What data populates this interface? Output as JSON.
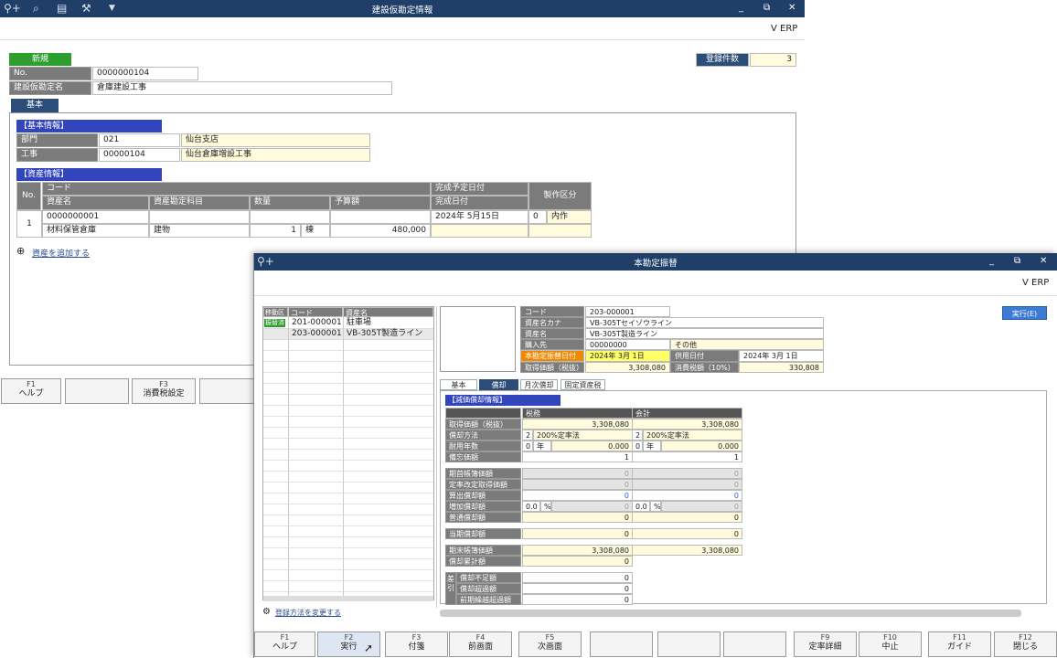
{
  "win1": {
    "title": "建設仮勘定情報",
    "brand": "V ERP",
    "status": "新規",
    "no_label": "No.",
    "no_value": "0000000104",
    "name_label": "建設仮勘定名",
    "name_value": "倉庫建設工事",
    "count_label": "登録件数",
    "count_value": "3",
    "tab": "基本",
    "basic_section": "【基本情報】",
    "dept_label": "部門",
    "dept_code": "021",
    "dept_name": "仙台支店",
    "work_label": "工事",
    "work_code": "00000104",
    "work_name": "仙台倉庫増設工事",
    "asset_section": "【資産情報】",
    "th_no": "No.",
    "th_code": "コード",
    "th_asset_name": "資産名",
    "th_account": "資産勘定科目",
    "th_qty": "数量",
    "th_budget": "予算額",
    "th_plan_date": "完成予定日付",
    "th_done_date": "完成日付",
    "th_make": "製作区分",
    "row_no": "1",
    "row_code": "0000000001",
    "row_name": "材料保管倉庫",
    "row_account": "建物",
    "row_qty": "1",
    "row_unit": "棟",
    "row_budget": "480,000",
    "row_plan_date": "2024年 5月15日",
    "row_make_code": "0",
    "row_make": "内作",
    "add_link": "資産を追加する",
    "fkeys": [
      {
        "k": "F1",
        "l": "ヘルプ"
      },
      {
        "k": "",
        "l": ""
      },
      {
        "k": "F3",
        "l": "消費税設定"
      },
      {
        "k": "",
        "l": ""
      }
    ]
  },
  "win2": {
    "title": "本勘定振替",
    "brand": "V ERP",
    "exec_btn": "実行(E)",
    "list_headers": [
      "移動区",
      "コード",
      "資産名"
    ],
    "list_rows": [
      {
        "st": "振替済",
        "code": "201-000001",
        "name": "駐車場"
      },
      {
        "st": "",
        "code": "203-000001",
        "name": "VB-305T製造ライン"
      }
    ],
    "change_link": "登録方法を変更する",
    "code_label": "コード",
    "code_value": "203-000001",
    "kana_label": "資産名カナ",
    "kana_value": "VB-305Tセイゾウライン",
    "name_label": "資産名",
    "name_value": "VB-305T製造ライン",
    "supplier_label": "購入先",
    "supplier_code": "00000000",
    "supplier_name": "その他",
    "transfer_label": "本勘定振替日付",
    "transfer_date": "2024年 3月 1日",
    "use_label": "供用日付",
    "use_date": "2024年 3月 1日",
    "cost_label": "取得価額（税抜）",
    "cost_value": "3,308,080",
    "tax_label": "消費税額（10%）",
    "tax_value": "330,808",
    "tabs": [
      "基本",
      "償却",
      "月次償却",
      "固定資産税"
    ],
    "dep_section": "【減価償却情報】",
    "col_tax": "税務",
    "col_acc": "会計",
    "d_cost": "取得価額（税抜）",
    "d_cost_t": "3,308,080",
    "d_cost_a": "3,308,080",
    "d_method": "償却方法",
    "d_method_tc": "2",
    "d_method_t": "200%定率法",
    "d_method_ac": "2",
    "d_method_a": "200%定率法",
    "d_life": "耐用年数",
    "d_life_t": "0",
    "d_life_tu": "年",
    "d_life_tr": "0.000",
    "d_life_a": "0",
    "d_life_au": "年",
    "d_life_ar": "0.000",
    "d_memo": "備忘価額",
    "d_memo_t": "1",
    "d_memo_a": "1",
    "d_open": "期首帳簿価額",
    "d_open_t": "0",
    "d_open_a": "0",
    "d_rev": "定率改定取得価額",
    "d_rev_t": "0",
    "d_rev_a": "0",
    "d_calc": "算出償却額",
    "d_calc_t": "0",
    "d_calc_a": "0",
    "d_add": "増加償却額",
    "d_add_tp": "0.0",
    "d_add_pu": "%",
    "d_add_t": "0",
    "d_add_ap": "0.0",
    "d_add_a": "0",
    "d_norm": "普通償却額",
    "d_norm_t": "0",
    "d_norm_a": "0",
    "d_cur": "当期償却額",
    "d_cur_t": "0",
    "d_cur_a": "0",
    "d_end": "期末帳簿価額",
    "d_end_t": "3,308,080",
    "d_end_a": "3,308,080",
    "d_acc": "償却累計額",
    "d_acc_t": "0",
    "diff_label": "差引",
    "d_short": "償却不足額",
    "d_short_t": "0",
    "d_over": "償却超過額",
    "d_over_t": "0",
    "d_prev": "前期繰越超過額",
    "d_prev_t": "0",
    "fkeys": [
      {
        "k": "F1",
        "l": "ヘルプ"
      },
      {
        "k": "F2",
        "l": "実行"
      },
      {
        "k": "F3",
        "l": "付箋"
      },
      {
        "k": "F4",
        "l": "前画面"
      },
      {
        "k": "F5",
        "l": "次画面"
      },
      {
        "k": "",
        "l": ""
      },
      {
        "k": "",
        "l": ""
      },
      {
        "k": "",
        "l": ""
      },
      {
        "k": "F9",
        "l": "定率詳細"
      },
      {
        "k": "F10",
        "l": "中止"
      },
      {
        "k": "F11",
        "l": "ガイド"
      },
      {
        "k": "F12",
        "l": "閉じる"
      }
    ]
  }
}
